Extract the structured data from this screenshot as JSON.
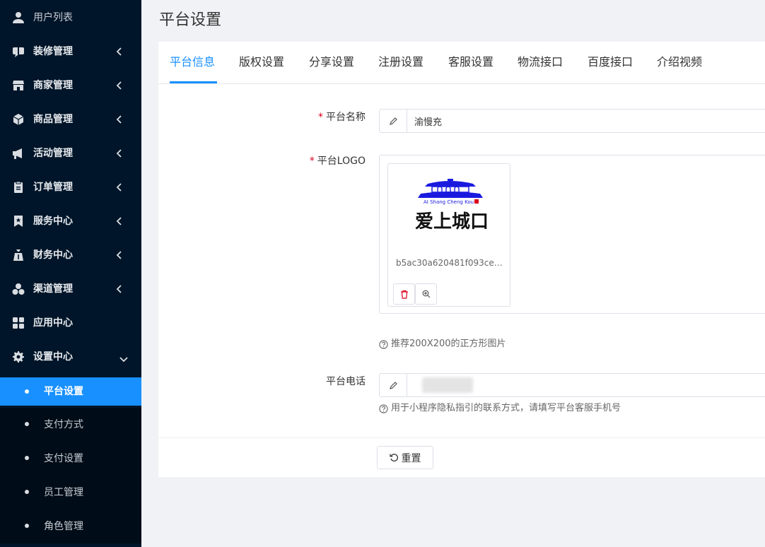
{
  "sidebar": {
    "menu": [
      {
        "label": "用户列表",
        "icon": "user-icon",
        "has_arrow": false
      },
      {
        "label": "装修管理",
        "icon": "chat-bubble-icon",
        "has_arrow": true
      },
      {
        "label": "商家管理",
        "icon": "store-icon",
        "has_arrow": true
      },
      {
        "label": "商品管理",
        "icon": "cube-icon",
        "has_arrow": true
      },
      {
        "label": "活动管理",
        "icon": "megaphone-icon",
        "has_arrow": true
      },
      {
        "label": "订单管理",
        "icon": "clipboard-icon",
        "has_arrow": true
      },
      {
        "label": "服务中心",
        "icon": "bookmark-star-icon",
        "has_arrow": true
      },
      {
        "label": "财务中心",
        "icon": "money-bag-icon",
        "has_arrow": true
      },
      {
        "label": "渠道管理",
        "icon": "cubes-icon",
        "has_arrow": true
      },
      {
        "label": "应用中心",
        "icon": "grid-icon",
        "has_arrow": false
      },
      {
        "label": "设置中心",
        "icon": "gear-icon",
        "has_arrow": true,
        "expanded": true
      }
    ],
    "submenu": [
      {
        "label": "平台设置",
        "active": true
      },
      {
        "label": "支付方式",
        "active": false
      },
      {
        "label": "支付设置",
        "active": false
      },
      {
        "label": "员工管理",
        "active": false
      },
      {
        "label": "角色管理",
        "active": false
      }
    ]
  },
  "page": {
    "title": "平台设置"
  },
  "tabs": [
    "平台信息",
    "版权设置",
    "分享设置",
    "注册设置",
    "客服设置",
    "物流接口",
    "百度接口",
    "介绍视频"
  ],
  "form": {
    "name_label": "平台名称",
    "name_value": "渝慢充",
    "logo_label": "平台LOGO",
    "logo_filename": "b5ac30a620481f093ce80...",
    "logo_text_main": "爱上城口",
    "logo_text_sub": "AI Shang Cheng Kou",
    "logo_hint": "推荐200X200的正方形图片",
    "phone_label": "平台电话",
    "phone_hint": "用于小程序隐私指引的联系方式，请填写平台客服手机号",
    "reset_label": "重置"
  },
  "colors": {
    "sidebar_bg": "#001529",
    "accent": "#1890ff",
    "required": "#d9001b",
    "logo_blue": "#1a1adf"
  }
}
